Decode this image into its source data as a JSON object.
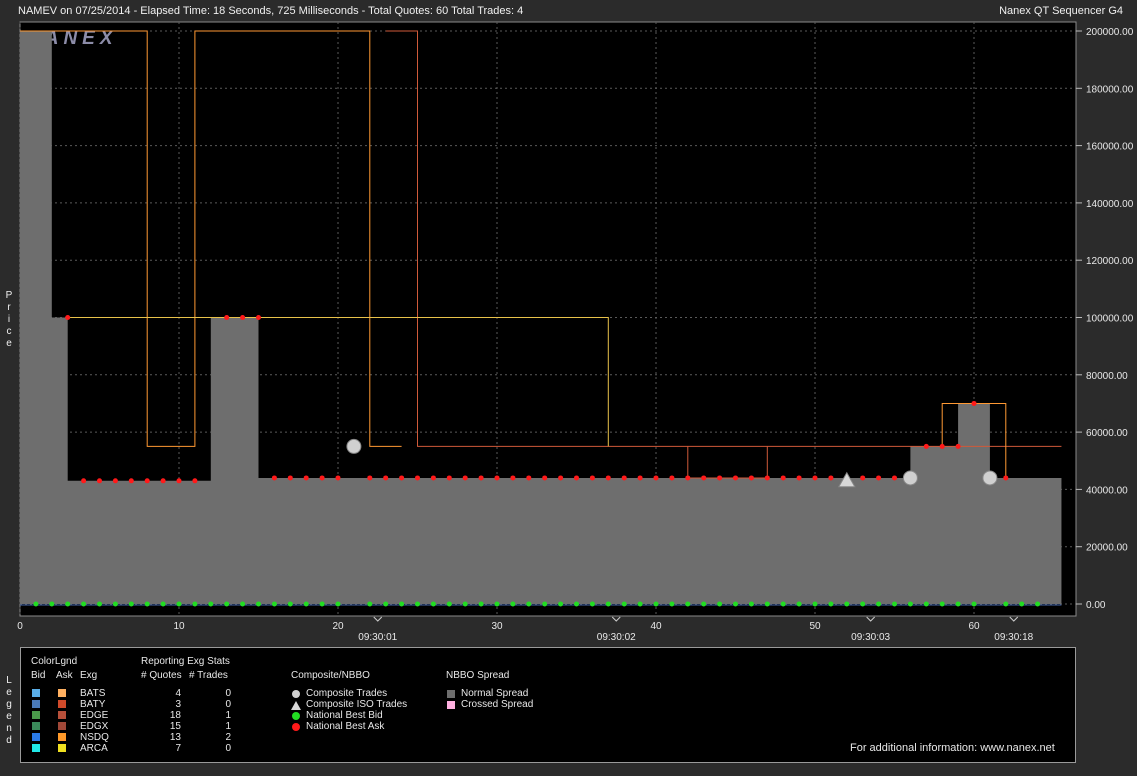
{
  "header": {
    "title_left": "NAMEV on 07/25/2014  -  Elapsed Time: 18 Seconds, 725 Milliseconds  -  Total Quotes: 60  Total Trades: 4",
    "title_right": "Nanex QT Sequencer G4",
    "watermark": "NANEX"
  },
  "side_labels": {
    "y_axis": "Price",
    "legend": "Legend"
  },
  "colors": {
    "plot_bg": "#000000",
    "spread_fill": "#6e6e6e",
    "grid": "#5a5a5a",
    "nbbo_bid": "#22dd22",
    "nbbo_ask": "#ff1a1a",
    "nsdq_ask": "#ff9933",
    "arca_ask": "#e8c24a",
    "edge_ask": "#d05a3a"
  },
  "chart_data": {
    "type": "line",
    "title": "NAMEV on 07/25/2014",
    "xlabel": "",
    "ylabel": "Price",
    "xlim": [
      0,
      66
    ],
    "ylim": [
      0,
      200000
    ],
    "x_ticks": [
      0,
      10,
      20,
      30,
      40,
      50,
      60
    ],
    "time_labels": [
      {
        "x": 22.5,
        "label": "09:30:01"
      },
      {
        "x": 37.5,
        "label": "09:30:02"
      },
      {
        "x": 53.5,
        "label": "09:30:03"
      },
      {
        "x": 62.5,
        "label": "09:30:18"
      }
    ],
    "y_ticks": [
      {
        "v": 0,
        "label": "0.00"
      },
      {
        "v": 20000,
        "label": "20000.00"
      },
      {
        "v": 40000,
        "label": "40000.00"
      },
      {
        "v": 60000,
        "label": "60000.00"
      },
      {
        "v": 80000,
        "label": "80000.00"
      },
      {
        "v": 100000,
        "label": "100000.00"
      },
      {
        "v": 120000,
        "label": "120000.00"
      },
      {
        "v": 140000,
        "label": "140000.00"
      },
      {
        "v": 160000,
        "label": "160000.00"
      },
      {
        "v": 180000,
        "label": "180000.00"
      },
      {
        "v": 200000,
        "label": "200000.00"
      }
    ],
    "grid": true,
    "normal_spread": [
      [
        0,
        200000
      ],
      [
        2,
        200000
      ],
      [
        2,
        100000
      ],
      [
        3,
        100000
      ],
      [
        3,
        43000
      ],
      [
        12,
        43000
      ],
      [
        12,
        100000
      ],
      [
        15,
        100000
      ],
      [
        15,
        44000
      ],
      [
        56,
        44000
      ],
      [
        56,
        55000
      ],
      [
        59,
        55000
      ],
      [
        59,
        70000
      ],
      [
        61,
        70000
      ],
      [
        61,
        44000
      ],
      [
        65.5,
        44000
      ]
    ],
    "nbbo_bid_points": [
      1,
      2,
      3,
      4,
      5,
      6,
      7,
      8,
      9,
      10,
      11,
      12,
      13,
      14,
      15,
      16,
      17,
      18,
      19,
      20,
      22,
      23,
      24,
      25,
      26,
      27,
      28,
      29,
      30,
      31,
      32,
      33,
      34,
      35,
      36,
      37,
      38,
      39,
      40,
      41,
      42,
      43,
      44,
      45,
      46,
      47,
      48,
      49,
      50,
      51,
      52,
      53,
      54,
      55,
      56,
      57,
      58,
      59,
      60,
      62,
      63,
      64
    ],
    "nbbo_bid_value": 0,
    "nbbo_ask_points": [
      [
        3,
        100000
      ],
      [
        4,
        43000
      ],
      [
        5,
        43000
      ],
      [
        6,
        43000
      ],
      [
        7,
        43000
      ],
      [
        8,
        43000
      ],
      [
        9,
        43000
      ],
      [
        10,
        43000
      ],
      [
        11,
        43000
      ],
      [
        13,
        100000
      ],
      [
        14,
        100000
      ],
      [
        15,
        100000
      ],
      [
        16,
        44000
      ],
      [
        17,
        44000
      ],
      [
        18,
        44000
      ],
      [
        19,
        44000
      ],
      [
        20,
        44000
      ],
      [
        22,
        44000
      ],
      [
        23,
        44000
      ],
      [
        24,
        44000
      ],
      [
        25,
        44000
      ],
      [
        26,
        44000
      ],
      [
        27,
        44000
      ],
      [
        28,
        44000
      ],
      [
        29,
        44000
      ],
      [
        30,
        44000
      ],
      [
        31,
        44000
      ],
      [
        32,
        44000
      ],
      [
        33,
        44000
      ],
      [
        34,
        44000
      ],
      [
        35,
        44000
      ],
      [
        36,
        44000
      ],
      [
        37,
        44000
      ],
      [
        38,
        44000
      ],
      [
        39,
        44000
      ],
      [
        40,
        44000
      ],
      [
        41,
        44000
      ],
      [
        42,
        44000
      ],
      [
        43,
        44000
      ],
      [
        44,
        44000
      ],
      [
        45,
        44000
      ],
      [
        46,
        44000
      ],
      [
        47,
        44000
      ],
      [
        48,
        44000
      ],
      [
        49,
        44000
      ],
      [
        50,
        44000
      ],
      [
        51,
        44000
      ],
      [
        52,
        44000
      ],
      [
        53,
        44000
      ],
      [
        54,
        44000
      ],
      [
        55,
        44000
      ],
      [
        57,
        55000
      ],
      [
        58,
        55000
      ],
      [
        59,
        55000
      ],
      [
        60,
        70000
      ],
      [
        62,
        44000
      ]
    ],
    "series_lines": [
      {
        "name": "NSDQ",
        "points": [
          [
            0,
            200000
          ],
          [
            8,
            200000
          ],
          [
            8,
            55000
          ],
          [
            11,
            55000
          ],
          [
            11,
            200000
          ],
          [
            22,
            200000
          ],
          [
            22,
            55000
          ],
          [
            24,
            55000
          ]
        ]
      },
      {
        "name": "EDGE",
        "points": [
          [
            23,
            200000
          ],
          [
            25,
            200000
          ],
          [
            25,
            55000
          ],
          [
            65.5,
            55000
          ]
        ]
      },
      {
        "name": "ARCA",
        "points": [
          [
            3,
            100000
          ],
          [
            37,
            100000
          ],
          [
            37,
            55000
          ]
        ]
      },
      {
        "name": "EDGX",
        "points": [
          [
            42,
            55000
          ],
          [
            42,
            44000
          ],
          [
            47,
            44000
          ],
          [
            47,
            55000
          ]
        ]
      },
      {
        "name": "NSDQ-2",
        "points": [
          [
            58,
            55000
          ],
          [
            58,
            70000
          ],
          [
            62,
            70000
          ],
          [
            62,
            44000
          ]
        ]
      }
    ],
    "composite_trades": [
      [
        21,
        55000
      ],
      [
        56,
        44000
      ],
      [
        61,
        44000
      ]
    ],
    "composite_iso_trades": [
      [
        52,
        43000
      ]
    ]
  },
  "legend": {
    "colorlgnd_title": "ColorLgnd",
    "col_bid": "Bid",
    "col_ask": "Ask",
    "col_exg": "Exg",
    "stats_title": "Reporting Exg Stats",
    "col_quotes": "# Quotes",
    "col_trades": "# Trades",
    "exchanges": [
      {
        "name": "BATS",
        "bid_color": "#5aaee8",
        "ask_color": "#ffb060",
        "quotes": "4",
        "trades": "0"
      },
      {
        "name": "BATY",
        "bid_color": "#4a7ab8",
        "ask_color": "#d04a2a",
        "quotes": "3",
        "trades": "0"
      },
      {
        "name": "EDGE",
        "bid_color": "#4a9a4a",
        "ask_color": "#b8503a",
        "quotes": "18",
        "trades": "1"
      },
      {
        "name": "EDGX",
        "bid_color": "#3a8a5a",
        "ask_color": "#a04838",
        "quotes": "15",
        "trades": "1"
      },
      {
        "name": "NSDQ",
        "bid_color": "#2a7ae8",
        "ask_color": "#ff9a2a",
        "quotes": "13",
        "trades": "2"
      },
      {
        "name": "ARCA",
        "bid_color": "#20e8e8",
        "ask_color": "#f0e020",
        "quotes": "7",
        "trades": "0"
      }
    ],
    "composite_title": "Composite/NBBO",
    "composite_items": {
      "trades": "Composite Trades",
      "iso": "Composite ISO Trades",
      "bid": "National Best Bid",
      "ask": "National Best Ask"
    },
    "spread_title": "NBBO Spread",
    "spread_items": {
      "normal": "Normal Spread",
      "crossed": "Crossed Spread"
    },
    "spread_colors": {
      "normal": "#6e6e6e",
      "crossed": "#ffb0e0"
    },
    "footer": "For additional information: www.nanex.net"
  }
}
